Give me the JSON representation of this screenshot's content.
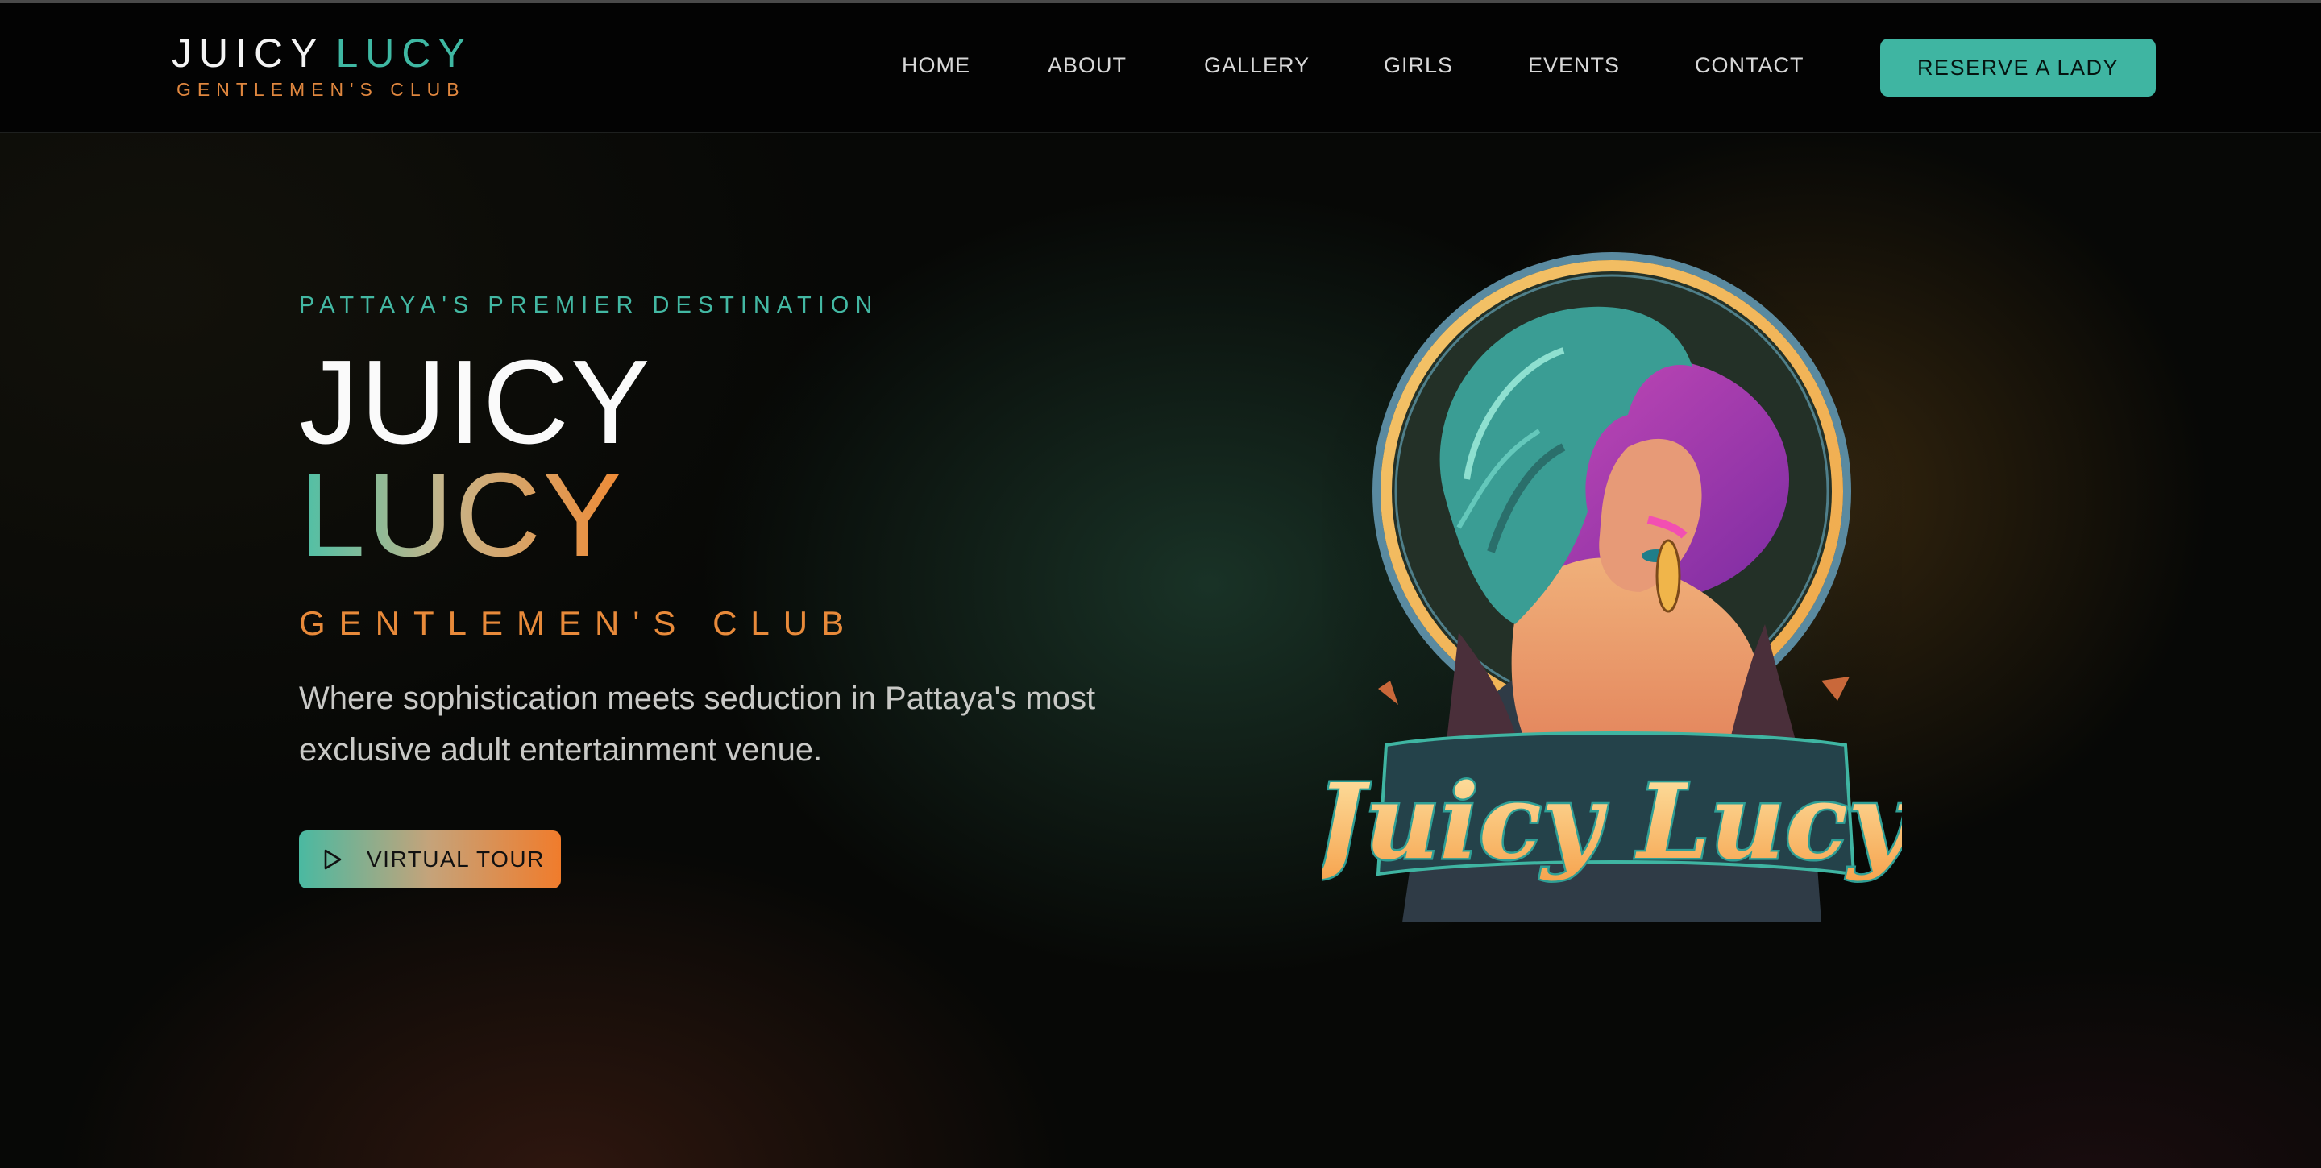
{
  "header": {
    "logo": {
      "word1": "JUICY",
      "word2": "LUCY",
      "tagline": "GENTLEMEN'S CLUB"
    },
    "nav": [
      "HOME",
      "ABOUT",
      "GALLERY",
      "GIRLS",
      "EVENTS",
      "CONTACT"
    ],
    "cta_label": "RESERVE A LADY"
  },
  "hero": {
    "kicker": "PATTAYA'S PREMIER DESTINATION",
    "title_line1": "JUICY",
    "title_line2": "LUCY",
    "subtitle": "GENTLEMEN'S CLUB",
    "description": "Where sophistication meets seduction in Pattaya's most exclusive adult entertainment venue.",
    "tour_label": "VIRTUAL TOUR",
    "tour_icon": "play-icon",
    "artwork_text": "Juicy Lucy"
  },
  "colors": {
    "teal": "#3fb5a2",
    "orange": "#e88a3a",
    "background": "#050505"
  }
}
